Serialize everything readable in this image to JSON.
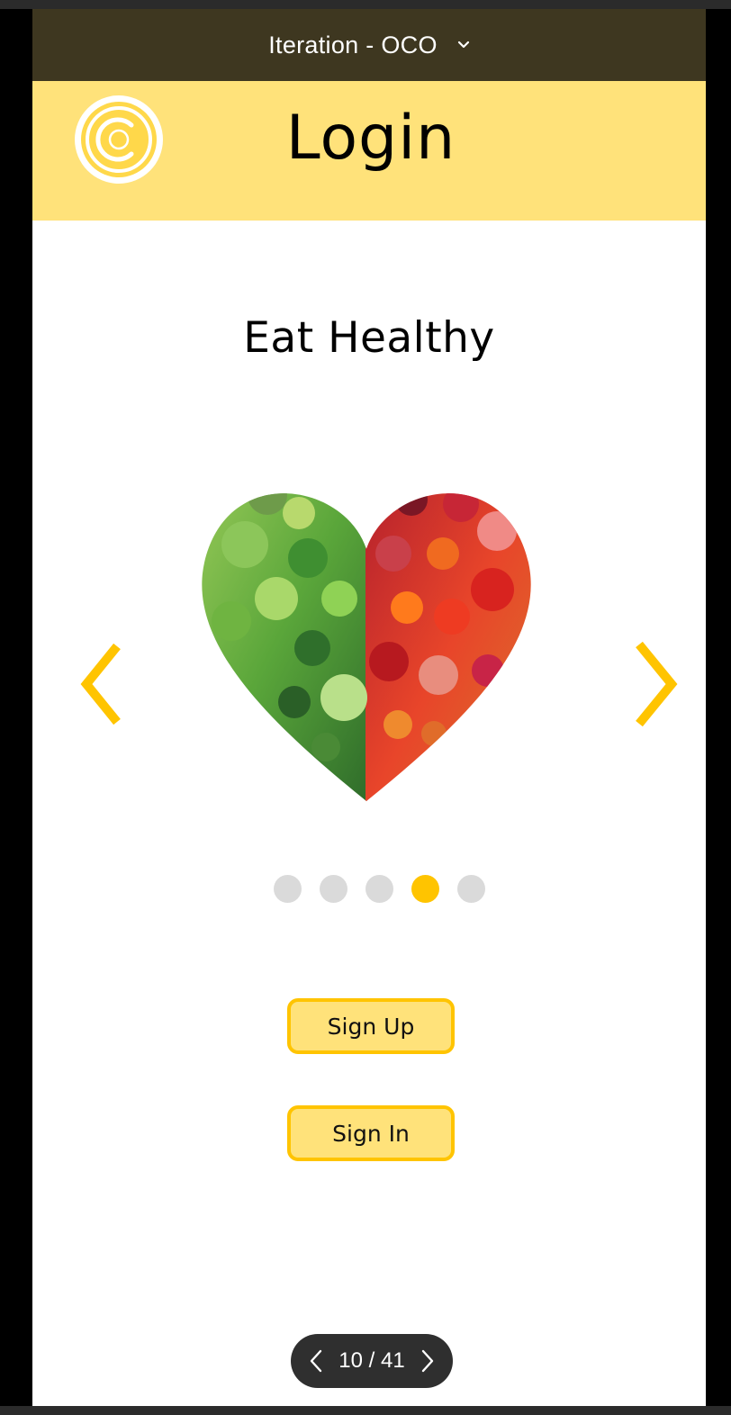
{
  "prototype_bar": {
    "title": "Iteration - OCO",
    "dropdown_icon": "chevron-down-icon",
    "background": "#3e3720"
  },
  "header": {
    "title": "Login",
    "logo_icon": "oco-logo",
    "background": "#ffe27a"
  },
  "carousel": {
    "slide_title": "Eat Healthy",
    "image": "vegetable-heart-image",
    "prev_icon": "chevron-left-icon",
    "next_icon": "chevron-right-icon",
    "total_dots": 5,
    "active_dot": 4,
    "accent": "#ffc400",
    "inactive_dot_color": "#dadada"
  },
  "buttons": {
    "sign_up": "Sign Up",
    "sign_in": "Sign In"
  },
  "pager": {
    "label": "10 / 41",
    "prev_icon": "chevron-left-icon",
    "next_icon": "chevron-right-icon"
  }
}
